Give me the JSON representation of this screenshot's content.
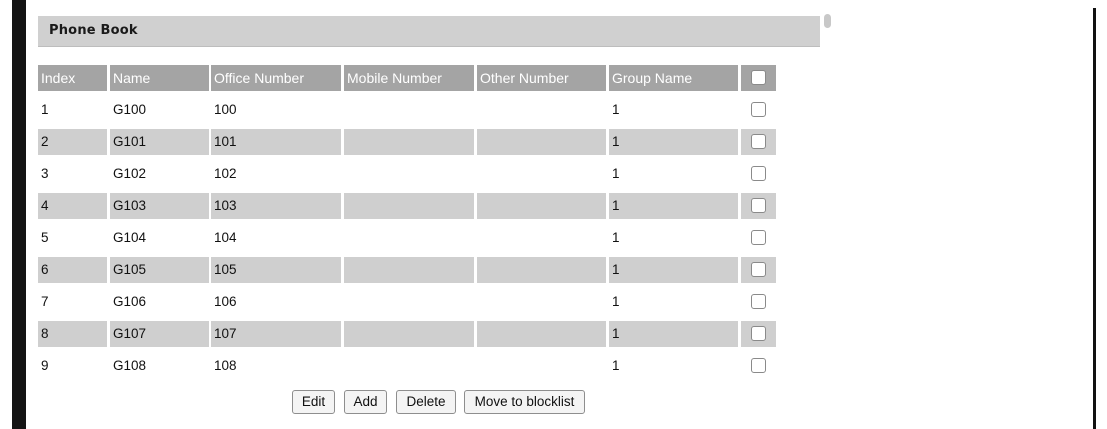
{
  "panel": {
    "title": "Phone Book"
  },
  "table": {
    "columns": [
      "Index",
      "Name",
      "Office Number",
      "Mobile Number",
      "Other Number",
      "Group Name"
    ],
    "rows": [
      {
        "index": "1",
        "name": "G100",
        "office": "100",
        "mobile": "",
        "other": "",
        "group": "1",
        "checked": false
      },
      {
        "index": "2",
        "name": "G101",
        "office": "101",
        "mobile": "",
        "other": "",
        "group": "1",
        "checked": false
      },
      {
        "index": "3",
        "name": "G102",
        "office": "102",
        "mobile": "",
        "other": "",
        "group": "1",
        "checked": false
      },
      {
        "index": "4",
        "name": "G103",
        "office": "103",
        "mobile": "",
        "other": "",
        "group": "1",
        "checked": false
      },
      {
        "index": "5",
        "name": "G104",
        "office": "104",
        "mobile": "",
        "other": "",
        "group": "1",
        "checked": false
      },
      {
        "index": "6",
        "name": "G105",
        "office": "105",
        "mobile": "",
        "other": "",
        "group": "1",
        "checked": false
      },
      {
        "index": "7",
        "name": "G106",
        "office": "106",
        "mobile": "",
        "other": "",
        "group": "1",
        "checked": false
      },
      {
        "index": "8",
        "name": "G107",
        "office": "107",
        "mobile": "",
        "other": "",
        "group": "1",
        "checked": false
      },
      {
        "index": "9",
        "name": "G108",
        "office": "108",
        "mobile": "",
        "other": "",
        "group": "1",
        "checked": false
      },
      {
        "index": "",
        "name": "",
        "office": "",
        "mobile": "",
        "other": "",
        "group": "",
        "checked": false
      }
    ]
  },
  "buttons": {
    "edit": "Edit",
    "add": "Add",
    "delete": "Delete",
    "move": "Move to blocklist"
  },
  "colors": {
    "header_bg": "#a4a4a4",
    "row_shade": "#cfcfcf",
    "panel_header": "#d0d0d0"
  }
}
